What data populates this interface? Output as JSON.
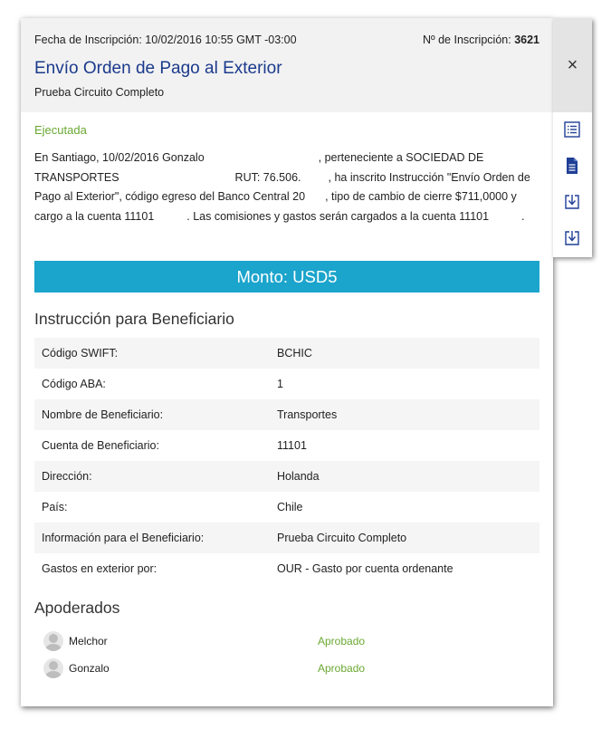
{
  "header": {
    "date_label": "Fecha de Inscripción:",
    "date_value": "10/02/2016 10:55 GMT -03:00",
    "number_label": "Nº de Inscripción:",
    "number_value": "3621",
    "title": "Envío Orden de Pago al Exterior",
    "subtitle": "Prueba Circuito Completo"
  },
  "status": "Ejecutada",
  "description": {
    "p1": "En Santiago, 10/02/2016 Gonzalo",
    "p2": ", perteneciente a SOCIEDAD DE TRANSPORTES",
    "p3": "RUT: 76.506.",
    "p4": ", ha inscrito Instrucción \"Envío Orden de Pago al Exterior\", código egreso del Banco Central 20",
    "p5": ", tipo de cambio de cierre $711,0000 y cargo a la cuenta 11101",
    "p6": ". Las comisiones y gastos serán cargados a la cuenta 11101",
    "p7": "."
  },
  "amount": "Monto: USD5",
  "beneficiary": {
    "section_title": "Instrucción para Beneficiario",
    "rows": [
      {
        "label": "Código SWIFT:",
        "value": "BCHIC"
      },
      {
        "label": "Código ABA:",
        "value": "1"
      },
      {
        "label": "Nombre de Beneficiario:",
        "value": "Transportes"
      },
      {
        "label": "Cuenta de Beneficiario:",
        "value": "11101"
      },
      {
        "label": "Dirección:",
        "value": "Holanda"
      },
      {
        "label": "País:",
        "value": "Chile"
      },
      {
        "label": "Información para el Beneficiario:",
        "value": "Prueba Circuito Completo"
      },
      {
        "label": "Gastos en exterior por:",
        "value": "OUR - Gasto por cuenta ordenante"
      }
    ]
  },
  "attorneys": {
    "section_title": "Apoderados",
    "items": [
      {
        "name": "Melchor",
        "status": "Aprobado"
      },
      {
        "name": "Gonzalo",
        "status": "Aprobado"
      }
    ]
  },
  "side_panel": {
    "close_glyph": "×",
    "icons": [
      "list-icon",
      "document-icon",
      "download-icon",
      "download-icon"
    ]
  },
  "colors": {
    "title": "#1b3a8c",
    "status_green": "#6aa832",
    "amount_bar": "#1ba4cc",
    "icon_blue": "#1f3f96"
  }
}
